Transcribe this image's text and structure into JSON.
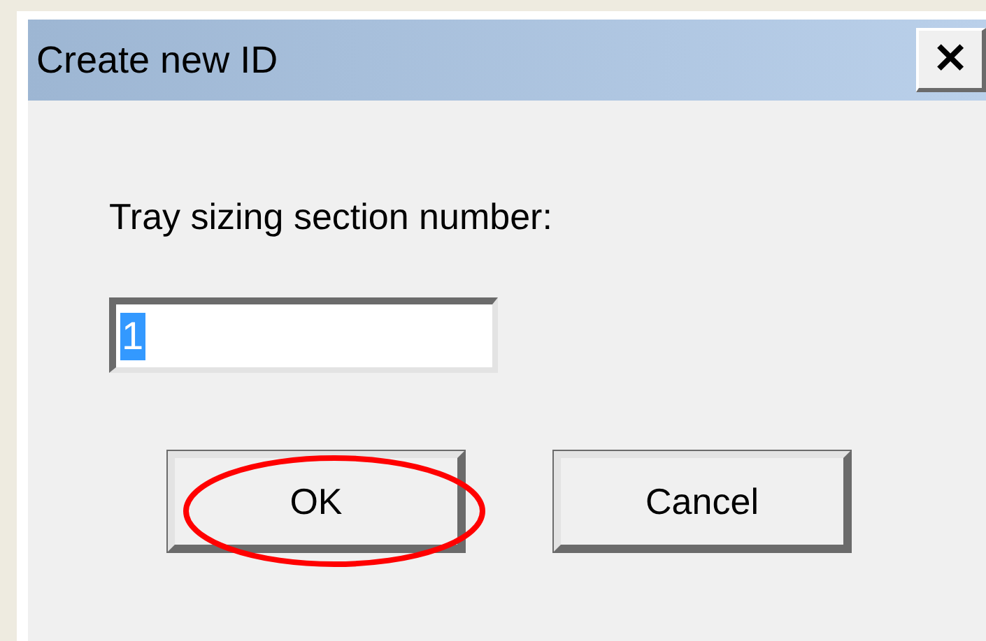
{
  "window": {
    "title": "Create new ID",
    "close_label": "✕"
  },
  "prompt": "Tray sizing section number:",
  "input": {
    "value": "1",
    "selected": true
  },
  "buttons": [
    {
      "label": "OK",
      "circled": true
    },
    {
      "label": "Cancel",
      "circled": false
    }
  ]
}
